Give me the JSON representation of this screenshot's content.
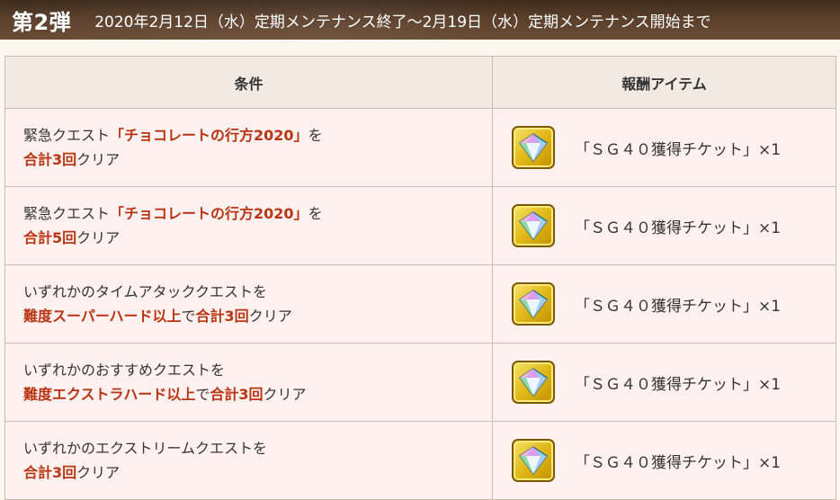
{
  "header": {
    "title": "第2弾",
    "period": "2020年2月12日（水）定期メンテナンス終了～2月19日（水）定期メンテナンス開始まで"
  },
  "table": {
    "col_condition": "条件",
    "col_reward": "報酬アイテム",
    "rows": [
      {
        "line1": [
          {
            "text": "緊急クエスト",
            "em": false
          },
          {
            "text": "「チョコレートの行方2020」",
            "em": true
          },
          {
            "text": "を",
            "em": false
          }
        ],
        "line2": [
          {
            "text": "合計3回",
            "em": true
          },
          {
            "text": "クリア",
            "em": false
          }
        ],
        "reward": "「ＳＧ４０獲得チケット」×1",
        "icon": "sg-ticket-gem-icon"
      },
      {
        "line1": [
          {
            "text": "緊急クエスト",
            "em": false
          },
          {
            "text": "「チョコレートの行方2020」",
            "em": true
          },
          {
            "text": "を",
            "em": false
          }
        ],
        "line2": [
          {
            "text": "合計5回",
            "em": true
          },
          {
            "text": "クリア",
            "em": false
          }
        ],
        "reward": "「ＳＧ４０獲得チケット」×1",
        "icon": "sg-ticket-gem-icon"
      },
      {
        "line1": [
          {
            "text": "いずれかのタイムアタッククエストを",
            "em": false
          }
        ],
        "line2": [
          {
            "text": "難度スーパーハード以上",
            "em": true
          },
          {
            "text": "で",
            "em": false
          },
          {
            "text": "合計3回",
            "em": true
          },
          {
            "text": "クリア",
            "em": false
          }
        ],
        "reward": "「ＳＧ４０獲得チケット」×1",
        "icon": "sg-ticket-gem-icon"
      },
      {
        "line1": [
          {
            "text": "いずれかのおすすめクエストを",
            "em": false
          }
        ],
        "line2": [
          {
            "text": "難度エクストラハード以上",
            "em": true
          },
          {
            "text": "で",
            "em": false
          },
          {
            "text": "合計3回",
            "em": true
          },
          {
            "text": "クリア",
            "em": false
          }
        ],
        "reward": "「ＳＧ４０獲得チケット」×1",
        "icon": "sg-ticket-gem-icon"
      },
      {
        "line1": [
          {
            "text": "いずれかのエクストリームクエストを",
            "em": false
          }
        ],
        "line2": [
          {
            "text": "合計3回",
            "em": true
          },
          {
            "text": "クリア",
            "em": false
          }
        ],
        "reward": "「ＳＧ４０獲得チケット」×1",
        "icon": "sg-ticket-gem-icon"
      }
    ]
  },
  "colors": {
    "emphasis": "#b73512",
    "header_bg": "#f3e9e3",
    "row_bg": "#fef1ef",
    "banner": "#4a3322"
  }
}
